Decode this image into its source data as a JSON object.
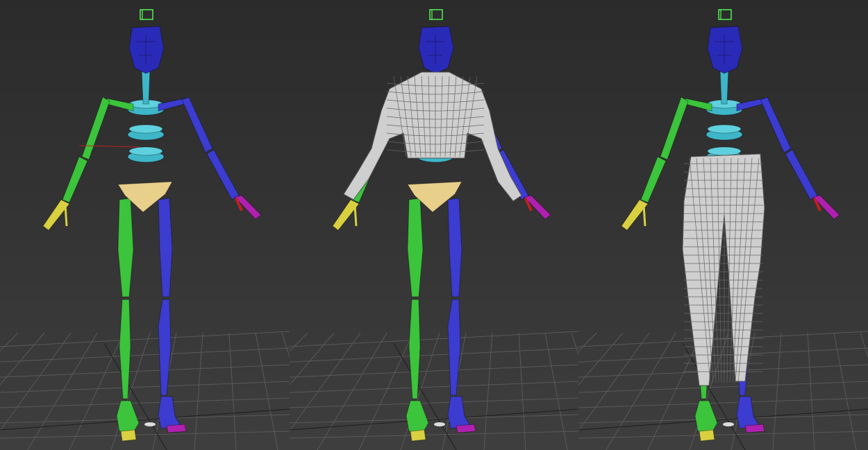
{
  "scene": {
    "viewports": [
      {
        "id": "vp1",
        "character_state": "bare-skeleton"
      },
      {
        "id": "vp2",
        "character_state": "torso-mesh"
      },
      {
        "id": "vp3",
        "character_state": "legs-mesh"
      }
    ],
    "colors": {
      "left_limb": "#3cc43c",
      "right_limb": "#3c3cd0",
      "spine": "#3fb6c8",
      "head": "#2a2ab8",
      "pelvis": "#e8cf8a",
      "mesh": "#cfcfcf",
      "grid": "#5a5a5a",
      "accent_red": "#c02020",
      "accent_magenta": "#b020b0",
      "accent_yellow": "#d8d040"
    }
  }
}
